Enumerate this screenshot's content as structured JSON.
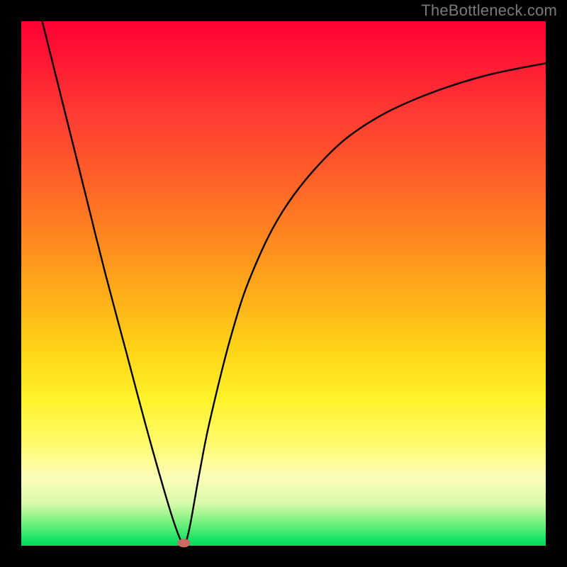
{
  "watermark": "TheBottleneck.com",
  "chart_data": {
    "type": "line",
    "title": "",
    "xlabel": "",
    "ylabel": "",
    "xlim": [
      0,
      100
    ],
    "ylim": [
      0,
      100
    ],
    "grid": false,
    "legend": false,
    "series": [
      {
        "name": "curve",
        "x": [
          4,
          8,
          12,
          16,
          20,
          24,
          28,
          30,
          31,
          32,
          34,
          36,
          40,
          44,
          50,
          58,
          66,
          76,
          88,
          100
        ],
        "y": [
          100,
          84,
          68,
          52,
          37,
          22,
          8,
          2,
          0.5,
          3,
          14,
          24,
          40,
          52,
          64,
          74,
          80.5,
          85.5,
          89.5,
          92
        ]
      }
    ],
    "marker": {
      "x": 31,
      "y": 0.5
    },
    "background": {
      "gradient_direction": "vertical",
      "stops": [
        {
          "pos": 0.0,
          "color": "#ff0033"
        },
        {
          "pos": 0.3,
          "color": "#ff6028"
        },
        {
          "pos": 0.64,
          "color": "#ffd918"
        },
        {
          "pos": 0.87,
          "color": "#fdfcbb"
        },
        {
          "pos": 1.0,
          "color": "#00db5a"
        }
      ]
    }
  }
}
